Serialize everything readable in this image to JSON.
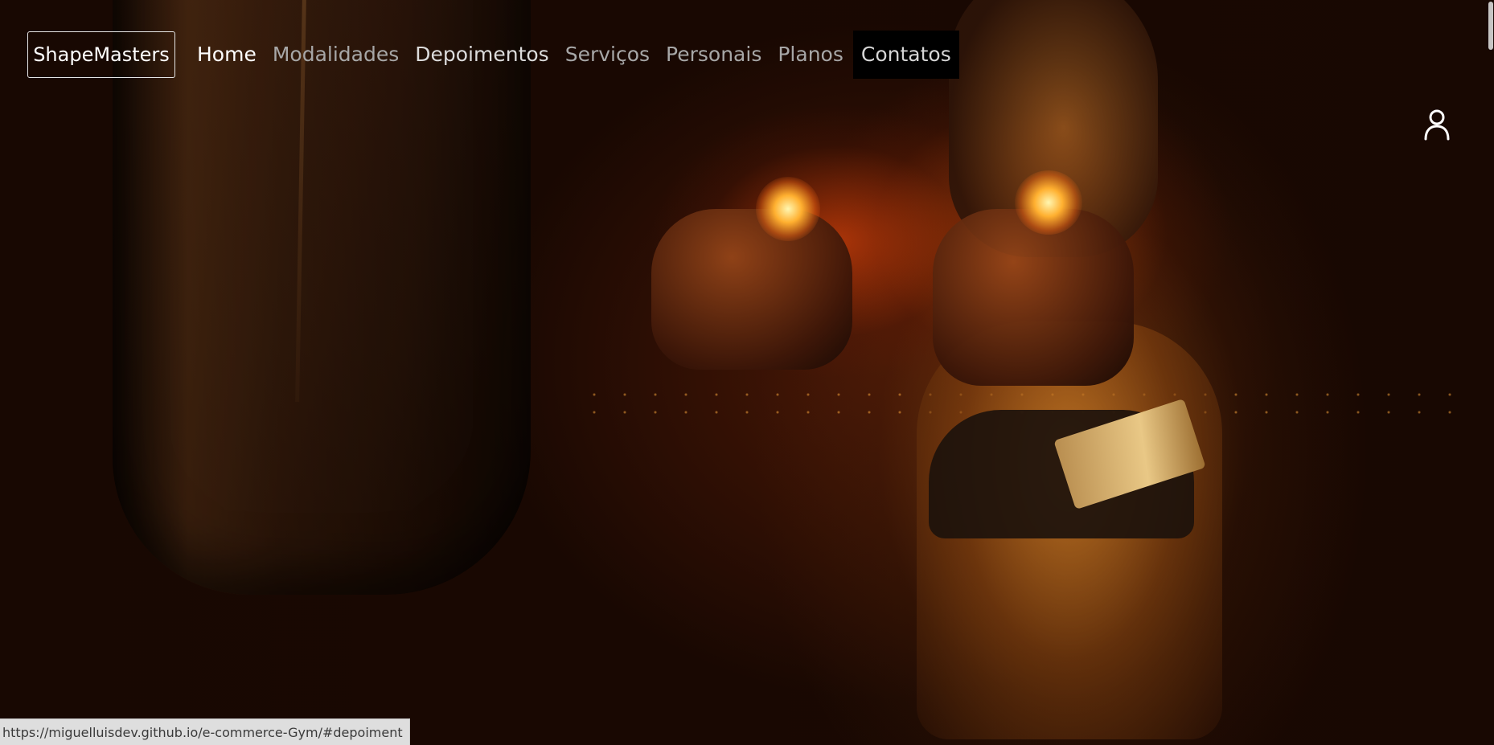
{
  "brand": {
    "label": "ShapeMasters"
  },
  "nav": {
    "items": [
      {
        "label": "Home",
        "state": "active"
      },
      {
        "label": "Modalidades",
        "state": "normal"
      },
      {
        "label": "Depoimentos",
        "state": "hover"
      },
      {
        "label": "Serviços",
        "state": "normal"
      },
      {
        "label": "Personais",
        "state": "normal"
      },
      {
        "label": "Planos",
        "state": "normal"
      },
      {
        "label": "Contatos",
        "state": "highlighted"
      }
    ]
  },
  "user": {
    "icon": "user-icon"
  },
  "status_bar": {
    "url": "https://miguelluisdev.github.io/e-commerce-Gym/#depoiment"
  },
  "colors": {
    "nav_text": "#a7a7a7",
    "nav_active": "#ffffff",
    "contact_bg": "#000000",
    "hero_glow": "#e6460a"
  }
}
